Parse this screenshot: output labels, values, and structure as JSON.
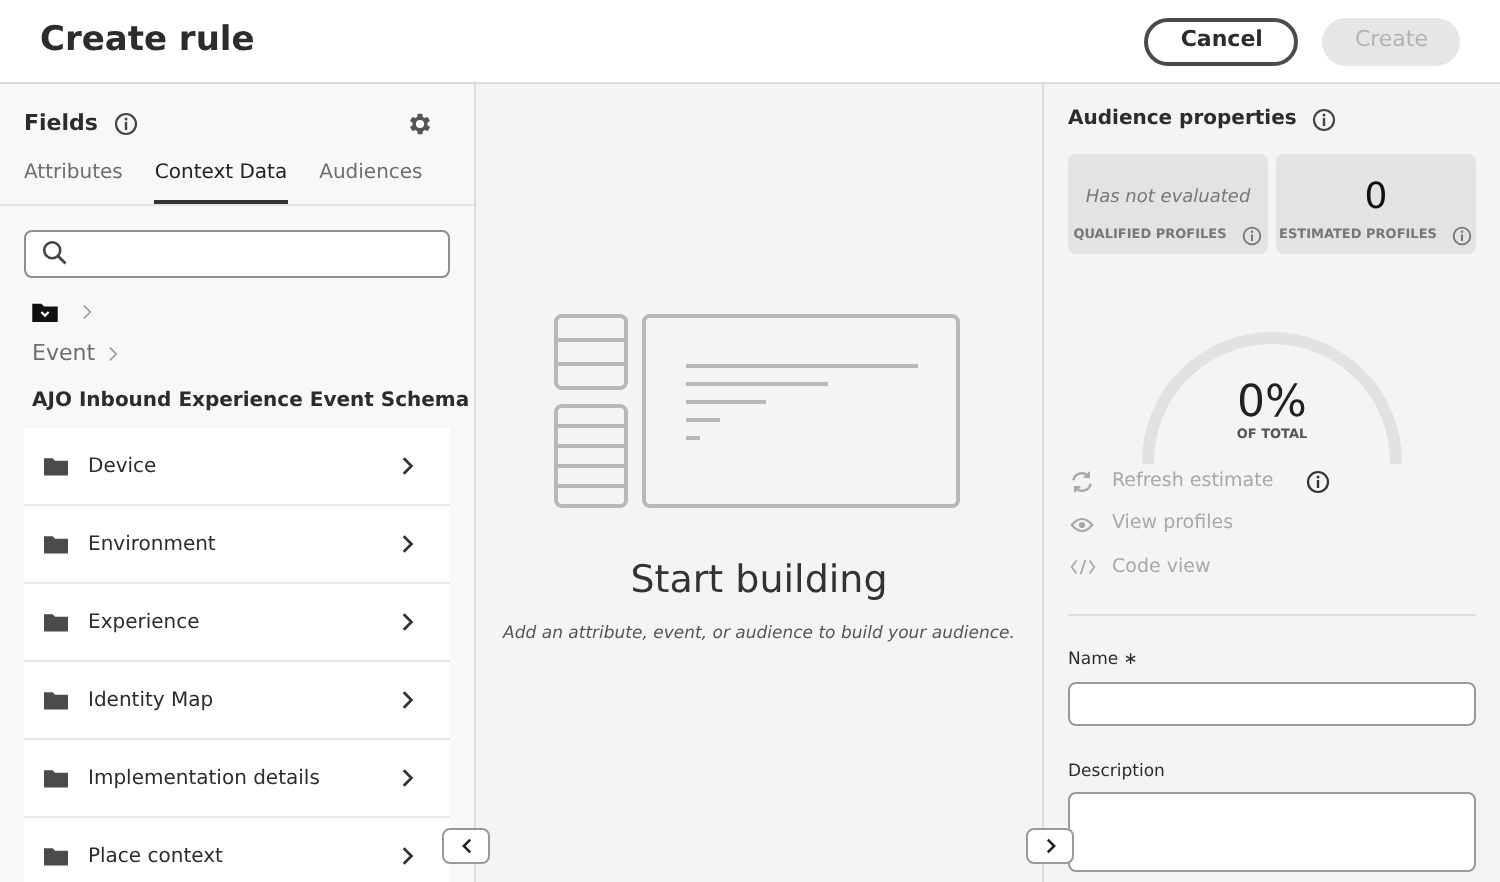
{
  "header": {
    "title": "Create rule",
    "buttons": [
      {
        "label": "Cancel",
        "disabled": false
      },
      {
        "label": "Create",
        "disabled": true
      }
    ]
  },
  "fields": {
    "title": "Fields",
    "tabs": [
      {
        "label": "Attributes",
        "selected": false
      },
      {
        "label": "Context Data",
        "selected": true
      },
      {
        "label": "Audiences",
        "selected": false
      }
    ],
    "breadcrumbs": [
      "Event"
    ],
    "schema_title": "AJO Inbound Experience Event Schema",
    "items": [
      {
        "label": "Device"
      },
      {
        "label": "Environment"
      },
      {
        "label": "Experience"
      },
      {
        "label": "Identity Map"
      },
      {
        "label": "Implementation details"
      },
      {
        "label": "Place context"
      }
    ]
  },
  "canvas": {
    "title": "Start building",
    "subtitle": "Add an attribute, event, or audience to build your audience."
  },
  "properties": {
    "title": "Audience properties",
    "cards": [
      {
        "kind": "note",
        "value": "Has not evaluated",
        "label": "QUALIFIED PROFILES"
      },
      {
        "kind": "number",
        "value": "0",
        "label": "ESTIMATED PROFILES"
      }
    ],
    "gauge": {
      "value": "0%",
      "label": "OF TOTAL"
    },
    "actions": [
      {
        "kind": "refresh",
        "label": "Refresh estimate",
        "disabled": true,
        "info": true
      },
      {
        "kind": "eye",
        "label": "View profiles",
        "disabled": true,
        "info": false
      },
      {
        "kind": "code",
        "label": "Code view",
        "disabled": true,
        "info": false
      }
    ],
    "name_field": {
      "label": "Name ∗"
    },
    "description_field": {
      "label": "Description"
    }
  }
}
